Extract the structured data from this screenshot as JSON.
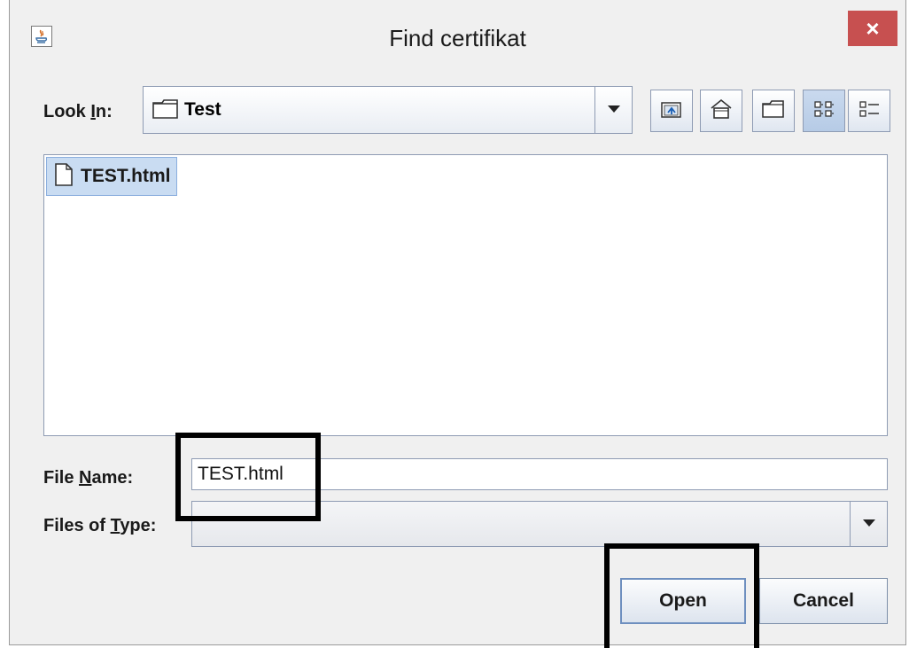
{
  "window": {
    "title": "Find certifikat",
    "close_glyph": "×"
  },
  "look_in": {
    "label_prefix": "Look ",
    "label_mnemonic": "I",
    "label_suffix": "n:",
    "value": "Test"
  },
  "toolbar": {
    "icons": [
      "up-one-level-icon",
      "home-icon",
      "new-folder-icon",
      "list-view-icon",
      "details-view-icon"
    ]
  },
  "file_list": {
    "items": [
      {
        "name": "TEST.html",
        "selected": true
      }
    ]
  },
  "file_name": {
    "label_prefix": "File ",
    "label_mnemonic": "N",
    "label_suffix": "ame:",
    "value": "TEST.html"
  },
  "files_of_type": {
    "label_prefix": "Files of ",
    "label_mnemonic": "T",
    "label_suffix": "ype:",
    "value": ""
  },
  "buttons": {
    "open": "Open",
    "cancel": "Cancel"
  },
  "colors": {
    "close": "#c75050",
    "selection": "#c9dcf2",
    "window": "#f0f0f0",
    "annotation": "#000000"
  }
}
